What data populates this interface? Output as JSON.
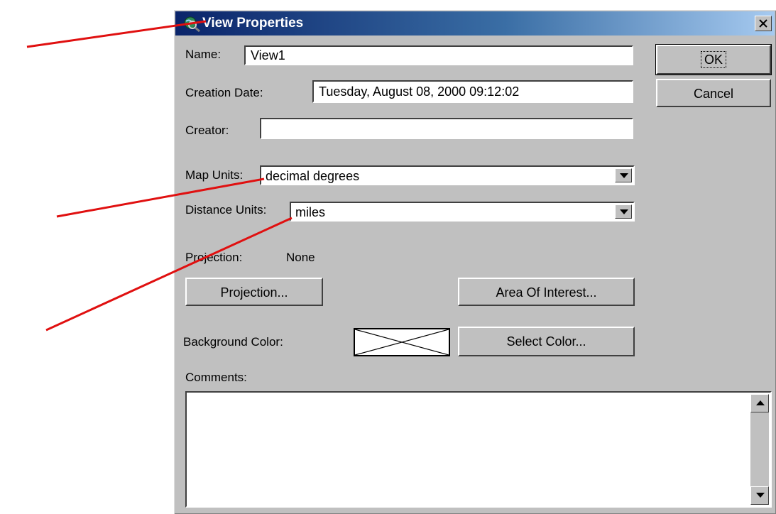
{
  "window": {
    "title": "View Properties"
  },
  "fields": {
    "name_label": "Name:",
    "name_value": "View1",
    "creation_date_label": "Creation Date:",
    "creation_date_value": "Tuesday, August 08, 2000 09:12:02",
    "creator_label": "Creator:",
    "creator_value": "",
    "map_units_label": "Map Units:",
    "map_units_value": "decimal degrees",
    "distance_units_label": "Distance Units:",
    "distance_units_value": "miles",
    "projection_label": "Projection:",
    "projection_value": "None",
    "background_color_label": "Background Color:",
    "comments_label": "Comments:",
    "comments_value": ""
  },
  "buttons": {
    "ok": "OK",
    "cancel": "Cancel",
    "projection": "Projection...",
    "area_of_interest": "Area Of Interest...",
    "select_color": "Select Color..."
  },
  "colors": {
    "title_bar": "#0a246a",
    "dialog_face": "#c0c0c0",
    "annotation_arrow": "#e01010"
  },
  "icons": {
    "app": "globe-magnifier-icon",
    "close": "close-icon",
    "dropdown": "chevron-down-icon",
    "scroll_up": "scroll-up-icon",
    "scroll_down": "scroll-down-icon"
  }
}
